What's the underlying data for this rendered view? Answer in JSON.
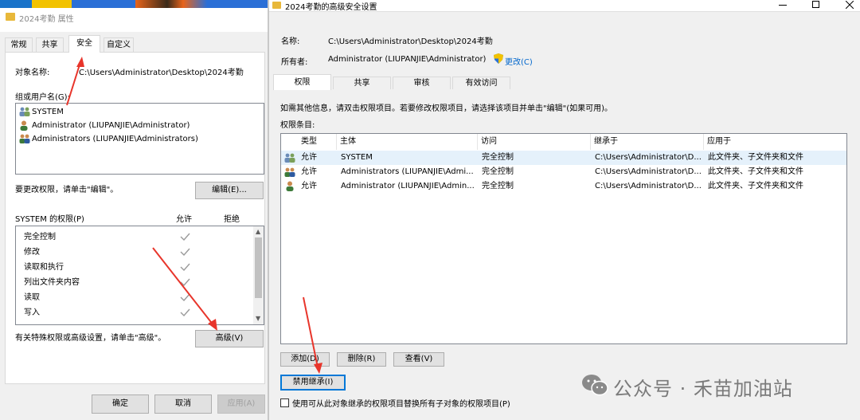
{
  "left_window": {
    "title": "2024考勤 属性",
    "tabs": [
      "常规",
      "共享",
      "安全",
      "自定义"
    ],
    "object_label": "对象名称:",
    "object_value": "C:\\Users\\Administrator\\Desktop\\2024考勤",
    "groups_label": "组或用户名(G):",
    "groups": [
      "SYSTEM",
      "Administrator (LIUPANJIE\\Administrator)",
      "Administrators (LIUPANJIE\\Administrators)"
    ],
    "edit_hint": "要更改权限，请单击\"编辑\"。",
    "edit_button": "编辑(E)...",
    "perm_header": "SYSTEM 的权限(P)",
    "allow_label": "允许",
    "deny_label": "拒绝",
    "permissions": [
      "完全控制",
      "修改",
      "读取和执行",
      "列出文件夹内容",
      "读取",
      "写入"
    ],
    "advanced_hint": "有关特殊权限或高级设置，请单击\"高级\"。",
    "advanced_button": "高级(V)",
    "ok_button": "确定",
    "cancel_button": "取消",
    "apply_button": "应用(A)"
  },
  "right_window": {
    "title": "2024考勤的高级安全设置",
    "name_label": "名称:",
    "name_value": "C:\\Users\\Administrator\\Desktop\\2024考勤",
    "owner_label": "所有者:",
    "owner_value": "Administrator (LIUPANJIE\\Administrator)",
    "change_link": "更改(C)",
    "tabs": [
      "权限",
      "共享",
      "审核",
      "有效访问"
    ],
    "info_text": "如需其他信息，请双击权限项目。若要修改权限项目，请选择该项目并单击\"编辑\"(如果可用)。",
    "entries_label": "权限条目:",
    "columns": [
      "类型",
      "主体",
      "访问",
      "继承于",
      "应用于"
    ],
    "rows": [
      {
        "type": "允许",
        "principal": "SYSTEM",
        "access": "完全控制",
        "inherited": "C:\\Users\\Administrator\\D...",
        "applies": "此文件夹、子文件夹和文件"
      },
      {
        "type": "允许",
        "principal": "Administrators (LIUPANJIE\\Admi...",
        "access": "完全控制",
        "inherited": "C:\\Users\\Administrator\\D...",
        "applies": "此文件夹、子文件夹和文件"
      },
      {
        "type": "允许",
        "principal": "Administrator (LIUPANJIE\\Admin...",
        "access": "完全控制",
        "inherited": "C:\\Users\\Administrator\\D...",
        "applies": "此文件夹、子文件夹和文件"
      }
    ],
    "add_button": "添加(D)",
    "remove_button": "删除(R)",
    "view_button": "查看(V)",
    "disable_inherit_button": "禁用继承(I)",
    "replace_checkbox_label": "使用可从此对象继承的权限项目替换所有子对象的权限项目(P)"
  },
  "watermark": "公众号 · 禾苗加油站",
  "colors": {
    "accent": "#0078d7",
    "annotation_arrow": "#e8352b",
    "link": "#0066cc"
  }
}
